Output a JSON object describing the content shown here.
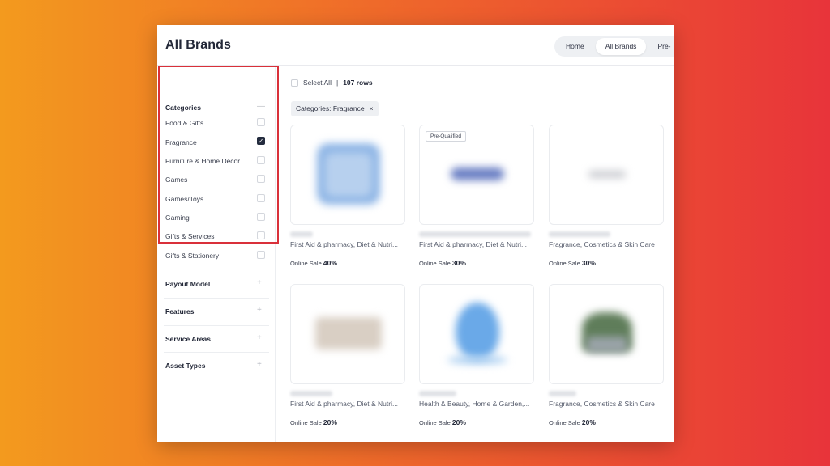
{
  "header": {
    "title": "All Brands",
    "tabs": [
      {
        "label": "Home",
        "active": false
      },
      {
        "label": "All Brands",
        "active": true
      },
      {
        "label": "Pre-",
        "active": false
      }
    ]
  },
  "sidebar": {
    "categories": {
      "title": "Categories",
      "toggle": "—",
      "items": [
        {
          "label": "Food & Gifts",
          "checked": false
        },
        {
          "label": "Fragrance",
          "checked": true
        },
        {
          "label": "Furniture & Home Decor",
          "checked": false
        },
        {
          "label": "Games",
          "checked": false
        },
        {
          "label": "Games/Toys",
          "checked": false
        },
        {
          "label": "Gaming",
          "checked": false
        },
        {
          "label": "Gifts & Services",
          "checked": false
        },
        {
          "label": "Gifts & Stationery",
          "checked": false
        }
      ]
    },
    "sections": [
      {
        "title": "Payout Model",
        "toggle": "+"
      },
      {
        "title": "Features",
        "toggle": "+"
      },
      {
        "title": "Service Areas",
        "toggle": "+"
      },
      {
        "title": "Asset Types",
        "toggle": "+"
      }
    ]
  },
  "main": {
    "select_all_label": "Select All",
    "separator": "|",
    "rows_count": "107 rows",
    "filter_chip": {
      "label": "Categories: Fragrance",
      "remove": "×"
    },
    "cards": [
      {
        "badge": "",
        "categories": "First Aid & pharmacy, Diet & Nutri...",
        "sale_label": "Online Sale",
        "sale_value": "40%",
        "logo_color": "#8fb6e6"
      },
      {
        "badge": "Pre-Qualified",
        "categories": "First Aid & pharmacy, Diet & Nutri...",
        "sale_label": "Online Sale",
        "sale_value": "30%",
        "logo_color": "#6a7fc4"
      },
      {
        "badge": "",
        "categories": "Fragrance, Cosmetics & Skin Care",
        "sale_label": "Online Sale",
        "sale_value": "30%",
        "logo_color": "#c9cbd0"
      },
      {
        "badge": "",
        "categories": "First Aid & pharmacy, Diet & Nutri...",
        "sale_label": "Online Sale",
        "sale_value": "20%",
        "logo_color": "#d9cfc4"
      },
      {
        "badge": "",
        "categories": "Health & Beauty, Home & Garden,...",
        "sale_label": "Online Sale",
        "sale_value": "20%",
        "logo_color": "#6aa9e8"
      },
      {
        "badge": "",
        "categories": "Fragrance, Cosmetics & Skin Care",
        "sale_label": "Online Sale",
        "sale_value": "20%",
        "logo_color": "#5f7d5a"
      }
    ]
  },
  "colors": {
    "highlight": "#d9303a",
    "accent_dark": "#232b3e"
  }
}
